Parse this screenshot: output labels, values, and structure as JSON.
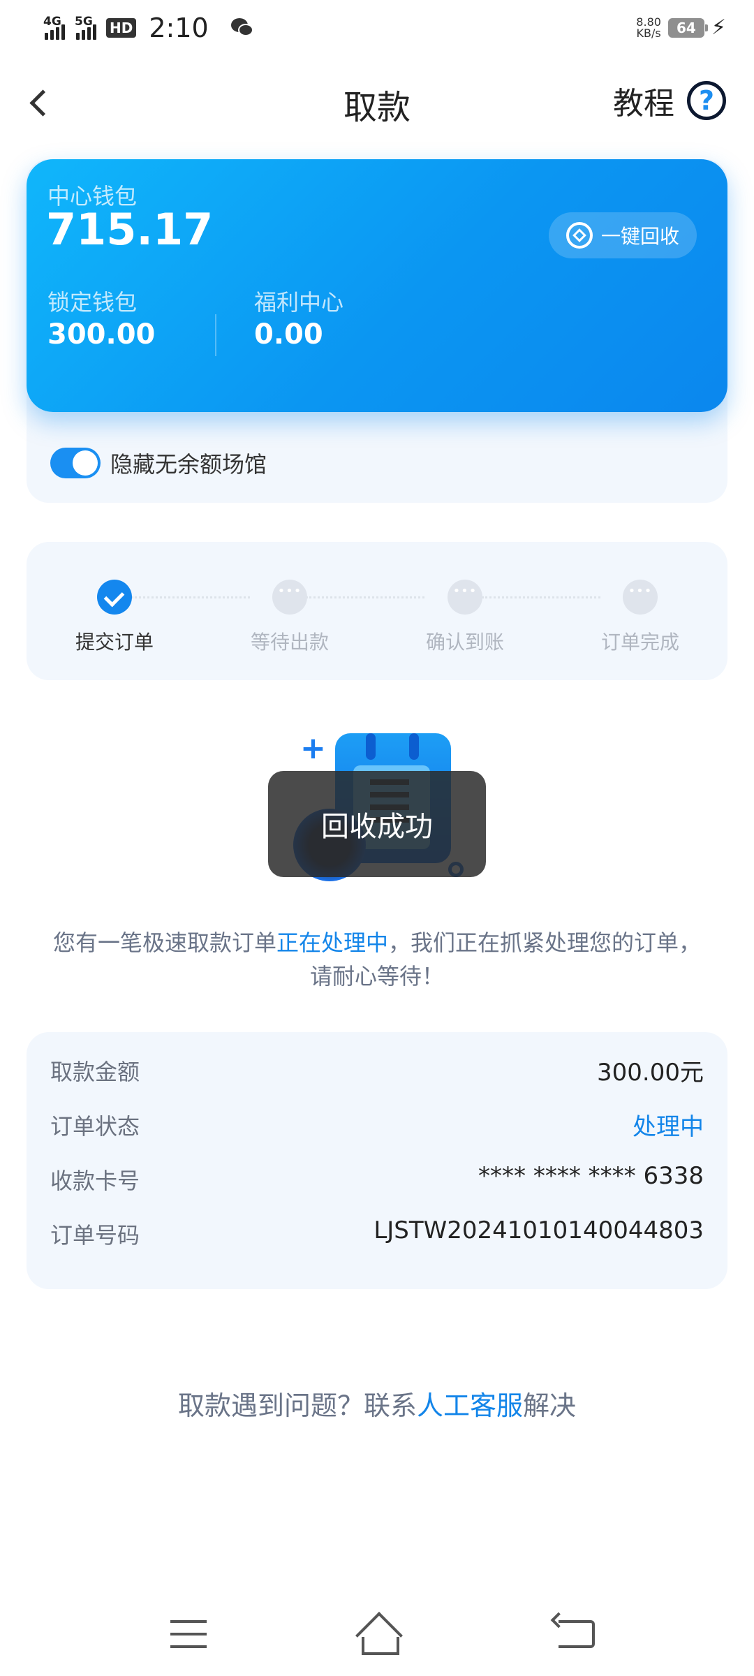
{
  "status_bar": {
    "net1": "4G",
    "net2": "5G",
    "hd": "HD",
    "time": "2:10",
    "net_speed_value": "8.80",
    "net_speed_unit": "KB/s",
    "battery": "64"
  },
  "header": {
    "title": "取款",
    "tutorial_label": "教程",
    "help_glyph": "?"
  },
  "wallet": {
    "center_label": "中心钱包",
    "center_value": "715.17",
    "recycle_label": "一键回收",
    "locked_label": "锁定钱包",
    "locked_value": "300.00",
    "welfare_label": "福利中心",
    "welfare_value": "0.00",
    "hide_toggle_label": "隐藏无余额场馆",
    "hide_toggle_on": true
  },
  "steps": [
    {
      "label": "提交订单",
      "status": "done"
    },
    {
      "label": "等待出款",
      "status": "pending"
    },
    {
      "label": "确认到账",
      "status": "pending"
    },
    {
      "label": "订单完成",
      "status": "pending"
    }
  ],
  "toast": "回收成功",
  "info": {
    "part1": "您有一笔极速取款订单",
    "highlight": "正在处理中",
    "part2": "，我们正在抓紧处理您的订单，",
    "line2": "请耐心等待！"
  },
  "order": {
    "amount_label": "取款金额",
    "amount_value": "300.00元",
    "status_label": "订单状态",
    "status_value": "处理中",
    "card_label": "收款卡号",
    "card_value": "**** **** **** 6338",
    "number_label": "订单号码",
    "number_value": "LJSTW20241010140044803"
  },
  "footer": {
    "prefix": "取款遇到问题？联系",
    "link": "人工客服",
    "suffix": "解决"
  },
  "colors": {
    "accent": "#1385e9",
    "card_gradient_start": "#10b6fb",
    "card_gradient_end": "#0b87ee"
  }
}
